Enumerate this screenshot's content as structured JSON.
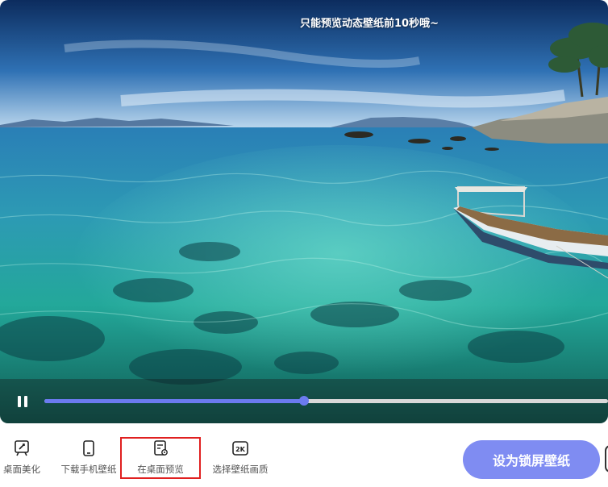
{
  "banner": {
    "text": "只能预览动态壁纸前10秒哦~"
  },
  "player": {
    "progress": 0.46
  },
  "toolbar": {
    "items": [
      {
        "id": "beautify",
        "label": "桌面美化",
        "icon": "desktop-beautify-icon"
      },
      {
        "id": "download",
        "label": "下载手机壁纸",
        "icon": "phone-icon"
      },
      {
        "id": "preview",
        "label": "在桌面预览",
        "icon": "desktop-preview-icon"
      },
      {
        "id": "quality",
        "label": "选择壁纸画质",
        "icon": "quality-2k-icon"
      }
    ],
    "quality_badge": "2K",
    "set_lockscreen_label": "设为锁屏壁纸"
  },
  "colors": {
    "accent": "#6b7bf0",
    "button": "#7f8cf2",
    "highlight": "#e02020"
  }
}
